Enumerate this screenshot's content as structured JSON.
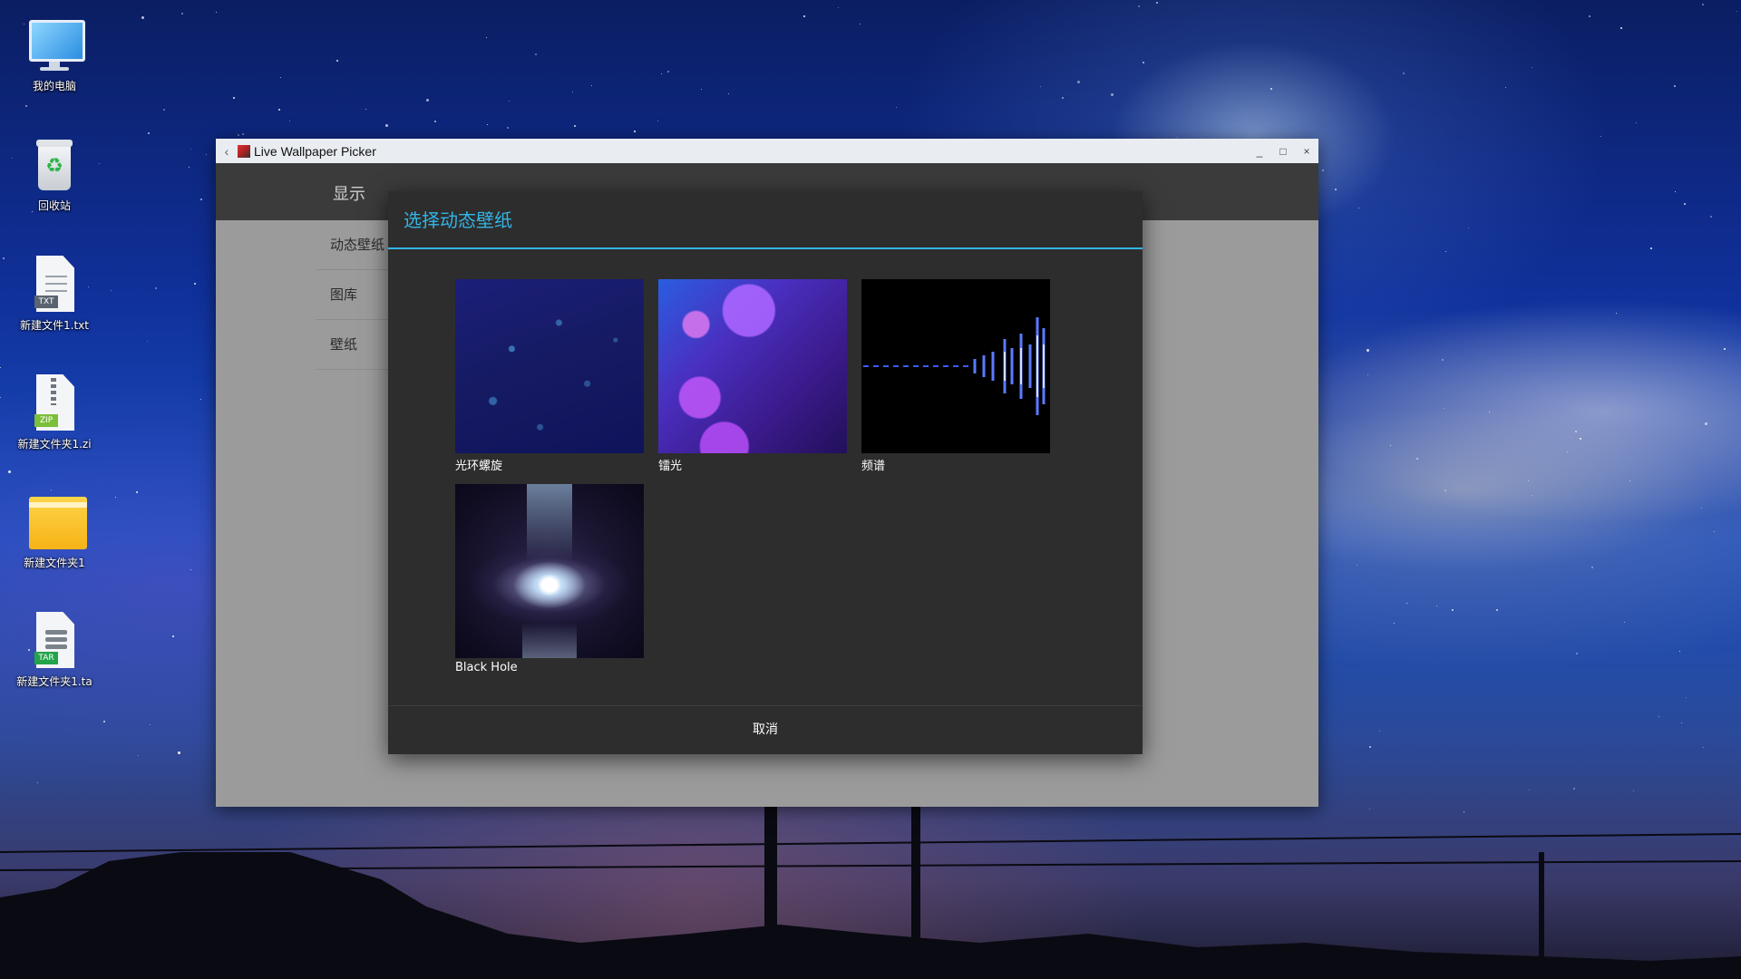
{
  "desktop": {
    "icons": [
      {
        "label": "我的电脑",
        "icon": "computer-icon"
      },
      {
        "label": "回收站",
        "icon": "recycle-bin-icon"
      },
      {
        "label": "新建文件1.txt",
        "icon": "txt-file-icon",
        "badge": "TXT"
      },
      {
        "label": "新建文件夹1.zi",
        "icon": "zip-file-icon",
        "badge": "ZIP"
      },
      {
        "label": "新建文件夹1",
        "icon": "folder-icon"
      },
      {
        "label": "新建文件夹1.ta",
        "icon": "tar-file-icon",
        "badge": "TAR"
      }
    ]
  },
  "window": {
    "title": "Live Wallpaper Picker",
    "back_glyph": "‹",
    "minimize_glyph": "_",
    "maximize_glyph": "□",
    "close_glyph": "×",
    "app_title": "显示",
    "list_items": [
      "动态壁纸",
      "图库",
      "壁纸"
    ]
  },
  "dialog": {
    "title": "选择动态壁纸",
    "wallpapers": [
      "光环螺旋",
      "镭光",
      "频谱",
      "Black Hole"
    ],
    "cancel_label": "取消"
  },
  "colors": {
    "accent": "#33b5e5",
    "dialog_bg": "#2d2d2d",
    "app_bar": "#3b3b3b",
    "window_bg": "#9b9b9b"
  }
}
